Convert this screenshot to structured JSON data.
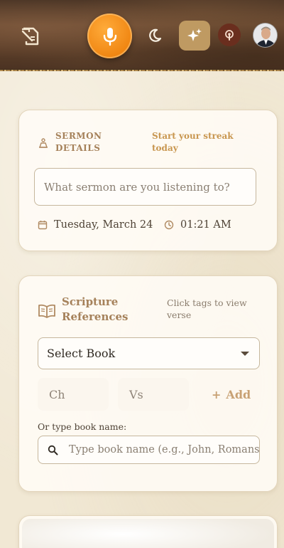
{
  "header": {
    "logo_icon": "quill-book-icon",
    "mic_icon": "microphone-icon",
    "theme_icon": "moon-icon",
    "ai_icon": "sparkles-icon",
    "podcast_icon": "podcast-pin-icon",
    "avatar": "user-avatar",
    "colors": {
      "mic": "#f08612",
      "sparkle_bg": "#bf9a62",
      "pin_bg": "#6a2e1e"
    }
  },
  "sermon_card": {
    "label": "SERMON DETAILS",
    "streak": "Start your streak today",
    "input_placeholder": "What sermon are you listening to?",
    "date": "Tuesday, March 24",
    "time": "01:21 AM"
  },
  "scripture_card": {
    "title": "Scripture References",
    "hint": "Click tags to view verse",
    "select_book": "Select Book",
    "chapter_placeholder": "Ch",
    "verse_placeholder": "Vs",
    "add_label": "Add",
    "type_label": "Or type book name:",
    "search_placeholder": "Type book name (e.g., John, Romans)"
  },
  "colors": {
    "accent": "#a5815a",
    "streak": "#c8964f",
    "background": "#f1e8d4"
  }
}
